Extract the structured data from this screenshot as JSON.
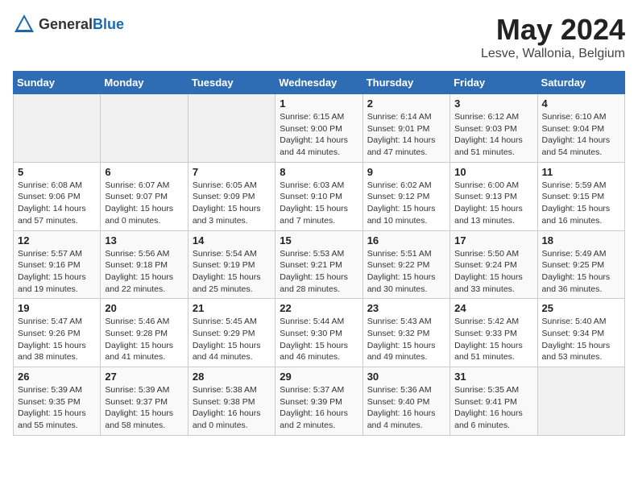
{
  "header": {
    "logo_general": "General",
    "logo_blue": "Blue",
    "month": "May 2024",
    "location": "Lesve, Wallonia, Belgium"
  },
  "days_of_week": [
    "Sunday",
    "Monday",
    "Tuesday",
    "Wednesday",
    "Thursday",
    "Friday",
    "Saturday"
  ],
  "weeks": [
    [
      {
        "day": "",
        "info": ""
      },
      {
        "day": "",
        "info": ""
      },
      {
        "day": "",
        "info": ""
      },
      {
        "day": "1",
        "info": "Sunrise: 6:15 AM\nSunset: 9:00 PM\nDaylight: 14 hours\nand 44 minutes."
      },
      {
        "day": "2",
        "info": "Sunrise: 6:14 AM\nSunset: 9:01 PM\nDaylight: 14 hours\nand 47 minutes."
      },
      {
        "day": "3",
        "info": "Sunrise: 6:12 AM\nSunset: 9:03 PM\nDaylight: 14 hours\nand 51 minutes."
      },
      {
        "day": "4",
        "info": "Sunrise: 6:10 AM\nSunset: 9:04 PM\nDaylight: 14 hours\nand 54 minutes."
      }
    ],
    [
      {
        "day": "5",
        "info": "Sunrise: 6:08 AM\nSunset: 9:06 PM\nDaylight: 14 hours\nand 57 minutes."
      },
      {
        "day": "6",
        "info": "Sunrise: 6:07 AM\nSunset: 9:07 PM\nDaylight: 15 hours\nand 0 minutes."
      },
      {
        "day": "7",
        "info": "Sunrise: 6:05 AM\nSunset: 9:09 PM\nDaylight: 15 hours\nand 3 minutes."
      },
      {
        "day": "8",
        "info": "Sunrise: 6:03 AM\nSunset: 9:10 PM\nDaylight: 15 hours\nand 7 minutes."
      },
      {
        "day": "9",
        "info": "Sunrise: 6:02 AM\nSunset: 9:12 PM\nDaylight: 15 hours\nand 10 minutes."
      },
      {
        "day": "10",
        "info": "Sunrise: 6:00 AM\nSunset: 9:13 PM\nDaylight: 15 hours\nand 13 minutes."
      },
      {
        "day": "11",
        "info": "Sunrise: 5:59 AM\nSunset: 9:15 PM\nDaylight: 15 hours\nand 16 minutes."
      }
    ],
    [
      {
        "day": "12",
        "info": "Sunrise: 5:57 AM\nSunset: 9:16 PM\nDaylight: 15 hours\nand 19 minutes."
      },
      {
        "day": "13",
        "info": "Sunrise: 5:56 AM\nSunset: 9:18 PM\nDaylight: 15 hours\nand 22 minutes."
      },
      {
        "day": "14",
        "info": "Sunrise: 5:54 AM\nSunset: 9:19 PM\nDaylight: 15 hours\nand 25 minutes."
      },
      {
        "day": "15",
        "info": "Sunrise: 5:53 AM\nSunset: 9:21 PM\nDaylight: 15 hours\nand 28 minutes."
      },
      {
        "day": "16",
        "info": "Sunrise: 5:51 AM\nSunset: 9:22 PM\nDaylight: 15 hours\nand 30 minutes."
      },
      {
        "day": "17",
        "info": "Sunrise: 5:50 AM\nSunset: 9:24 PM\nDaylight: 15 hours\nand 33 minutes."
      },
      {
        "day": "18",
        "info": "Sunrise: 5:49 AM\nSunset: 9:25 PM\nDaylight: 15 hours\nand 36 minutes."
      }
    ],
    [
      {
        "day": "19",
        "info": "Sunrise: 5:47 AM\nSunset: 9:26 PM\nDaylight: 15 hours\nand 38 minutes."
      },
      {
        "day": "20",
        "info": "Sunrise: 5:46 AM\nSunset: 9:28 PM\nDaylight: 15 hours\nand 41 minutes."
      },
      {
        "day": "21",
        "info": "Sunrise: 5:45 AM\nSunset: 9:29 PM\nDaylight: 15 hours\nand 44 minutes."
      },
      {
        "day": "22",
        "info": "Sunrise: 5:44 AM\nSunset: 9:30 PM\nDaylight: 15 hours\nand 46 minutes."
      },
      {
        "day": "23",
        "info": "Sunrise: 5:43 AM\nSunset: 9:32 PM\nDaylight: 15 hours\nand 49 minutes."
      },
      {
        "day": "24",
        "info": "Sunrise: 5:42 AM\nSunset: 9:33 PM\nDaylight: 15 hours\nand 51 minutes."
      },
      {
        "day": "25",
        "info": "Sunrise: 5:40 AM\nSunset: 9:34 PM\nDaylight: 15 hours\nand 53 minutes."
      }
    ],
    [
      {
        "day": "26",
        "info": "Sunrise: 5:39 AM\nSunset: 9:35 PM\nDaylight: 15 hours\nand 55 minutes."
      },
      {
        "day": "27",
        "info": "Sunrise: 5:39 AM\nSunset: 9:37 PM\nDaylight: 15 hours\nand 58 minutes."
      },
      {
        "day": "28",
        "info": "Sunrise: 5:38 AM\nSunset: 9:38 PM\nDaylight: 16 hours\nand 0 minutes."
      },
      {
        "day": "29",
        "info": "Sunrise: 5:37 AM\nSunset: 9:39 PM\nDaylight: 16 hours\nand 2 minutes."
      },
      {
        "day": "30",
        "info": "Sunrise: 5:36 AM\nSunset: 9:40 PM\nDaylight: 16 hours\nand 4 minutes."
      },
      {
        "day": "31",
        "info": "Sunrise: 5:35 AM\nSunset: 9:41 PM\nDaylight: 16 hours\nand 6 minutes."
      },
      {
        "day": "",
        "info": ""
      }
    ]
  ]
}
